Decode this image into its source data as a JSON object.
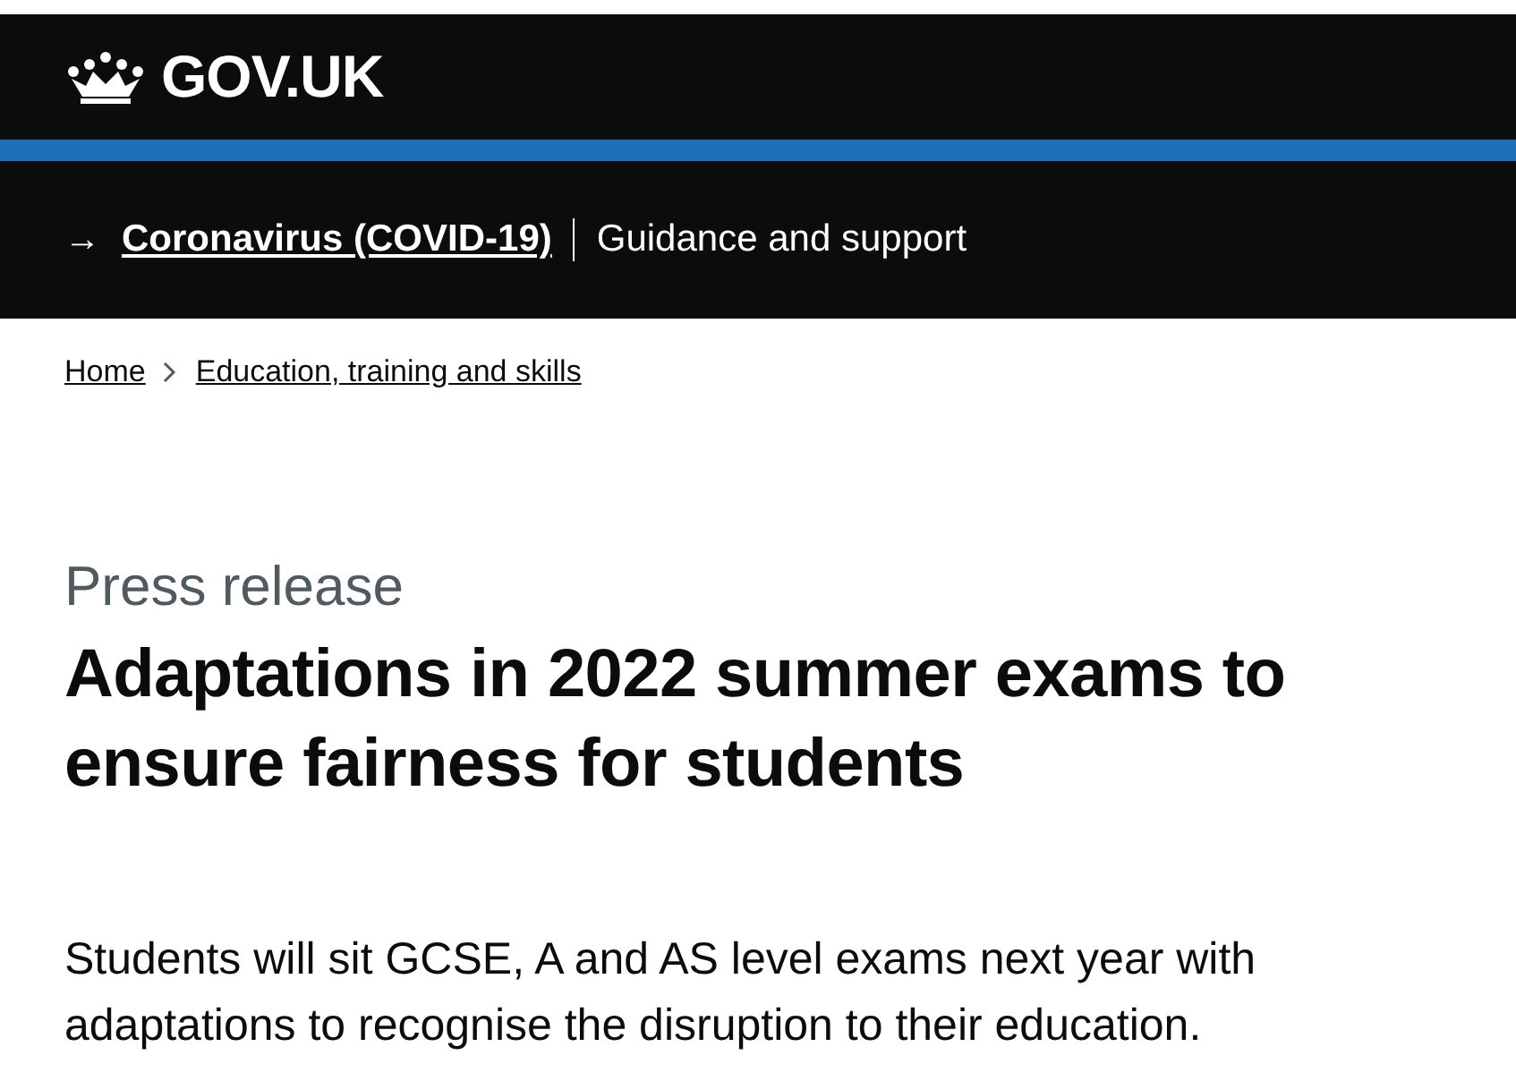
{
  "header": {
    "logo_text": "GOV.UK"
  },
  "banner": {
    "arrow": "→",
    "link": "Coronavirus (COVID-19)",
    "text": "Guidance and support"
  },
  "breadcrumbs": [
    {
      "label": "Home"
    },
    {
      "label": "Education, training and skills"
    }
  ],
  "caption": "Press release",
  "title": "Adaptations in 2022 summer exams to ensure fairness for students",
  "lead": "Students will sit GCSE, A and AS level exams next year with adaptations to recognise the disruption to their education."
}
